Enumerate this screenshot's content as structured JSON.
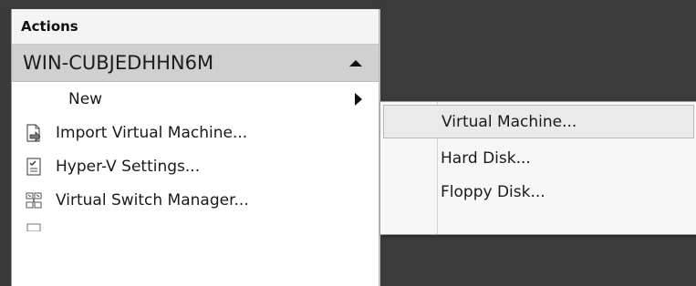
{
  "actions_pane": {
    "header": "Actions",
    "server_name": "WIN-CUBJEDHHN6M",
    "items": [
      {
        "label": "New",
        "icon": "none",
        "has_submenu": true
      },
      {
        "label": "Import Virtual Machine...",
        "icon": "import-vm-icon"
      },
      {
        "label": "Hyper-V Settings...",
        "icon": "settings-icon"
      },
      {
        "label": "Virtual Switch Manager...",
        "icon": "switch-manager-icon"
      }
    ]
  },
  "new_submenu": {
    "items": [
      {
        "label": "Virtual Machine..."
      },
      {
        "label": "Hard Disk..."
      },
      {
        "label": "Floppy Disk..."
      }
    ]
  }
}
